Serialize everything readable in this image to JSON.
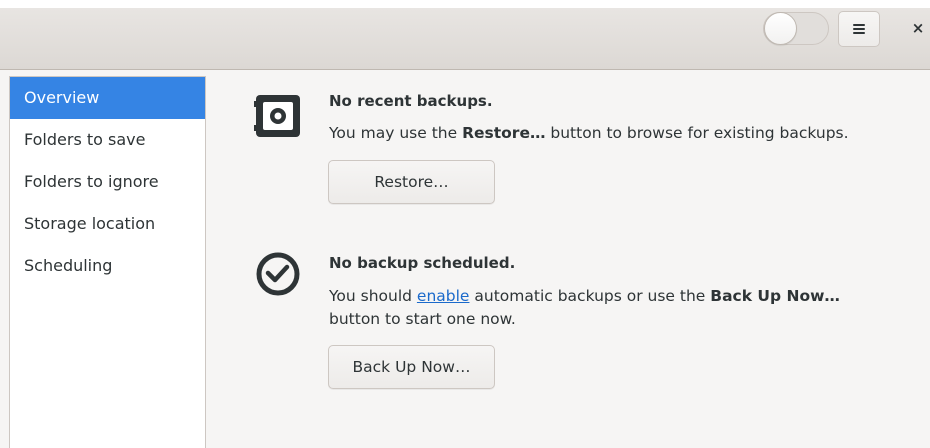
{
  "header": {
    "toggle_state": "off",
    "menu_icon": "hamburger-menu-icon",
    "close_label": "×"
  },
  "sidebar": {
    "items": [
      {
        "label": "Overview",
        "selected": true
      },
      {
        "label": "Folders to save",
        "selected": false
      },
      {
        "label": "Folders to ignore",
        "selected": false
      },
      {
        "label": "Storage location",
        "selected": false
      },
      {
        "label": "Scheduling",
        "selected": false
      }
    ]
  },
  "overview": {
    "backups": {
      "icon": "safe-icon",
      "title": "No recent backups.",
      "text_pre": "You may use the ",
      "text_bold": "Restore…",
      "text_post": " button to browse for existing backups.",
      "button_label": "Restore…"
    },
    "schedule": {
      "icon": "clock-icon",
      "title": "No backup scheduled.",
      "text_pre": "You should ",
      "link_label": "enable",
      "text_mid": " automatic backups or use the ",
      "text_bold": "Back Up Now…",
      "text_line2": "button to start one now.",
      "button_label": "Back Up Now…"
    }
  },
  "colors": {
    "accent": "#3584e4",
    "link": "#1b6acb",
    "text": "#2e3436",
    "background": "#f6f5f4"
  }
}
